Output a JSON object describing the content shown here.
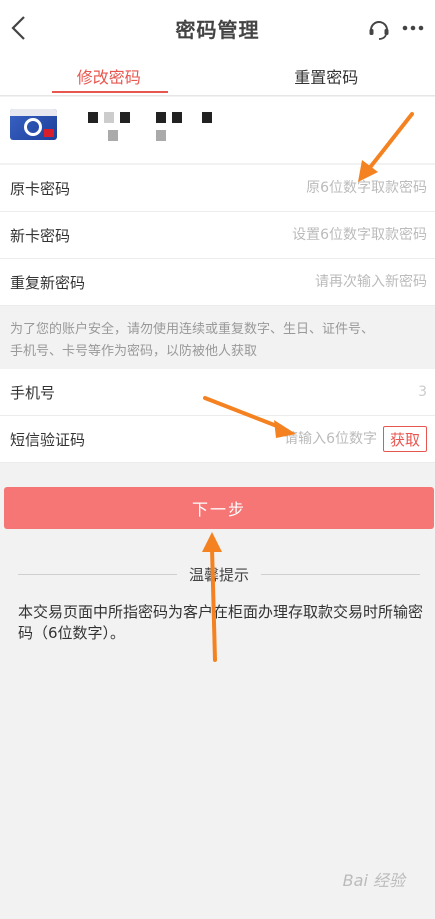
{
  "header": {
    "title": "密码管理",
    "back_icon": "chevron-left-icon",
    "service_icon": "headset-icon",
    "more_icon": "more-dots-icon"
  },
  "tabs": [
    {
      "label": "修改密码",
      "active": true
    },
    {
      "label": "重置密码",
      "active": false
    }
  ],
  "form": {
    "old_password": {
      "label": "原卡密码",
      "placeholder": "原6位数字取款密码"
    },
    "new_password": {
      "label": "新卡密码",
      "placeholder": "设置6位数字取款密码"
    },
    "repeat_password": {
      "label": "重复新密码",
      "placeholder": "请再次输入新密码"
    },
    "notice_line1": "为了您的账户安全，请勿使用连续或重复数字、生日、证件号、",
    "notice_line2": "手机号、卡号等作为密码，以防被他人获取",
    "phone": {
      "label": "手机号",
      "value": "3"
    },
    "sms": {
      "label": "短信验证码",
      "placeholder": "请输入6位数字",
      "get_button": "获取"
    }
  },
  "next_button": "下一步",
  "tips": {
    "title": "温馨提示",
    "text": "本交易页面中所指密码为客户在柜面办理存取款交易时所输密码（6位数字）。"
  },
  "watermark": "Bai 经验",
  "colors": {
    "accent": "#e8574f",
    "button": "#f67676",
    "arrow": "#f58220"
  }
}
